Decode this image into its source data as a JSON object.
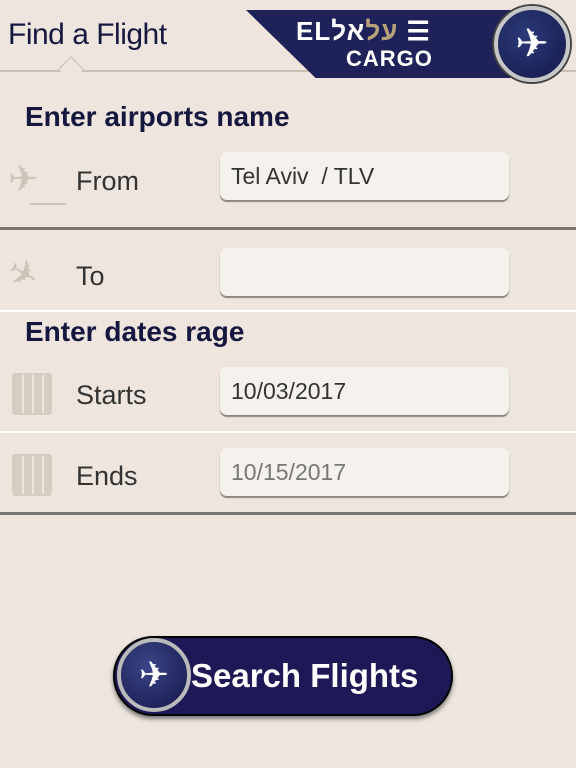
{
  "header": {
    "title": "Find a Flight",
    "logo_latin": "EL",
    "logo_hebrew": "על",
    "logo_hebrew2": "אל",
    "logo_sub": "CARGO"
  },
  "airports": {
    "heading": "Enter airports name",
    "from_label": "From",
    "from_value": "Tel Aviv  / TLV",
    "to_label": "To",
    "to_value": ""
  },
  "dates": {
    "heading": "Enter dates rage",
    "starts_label": "Starts",
    "starts_value": "10/03/2017",
    "ends_label": "Ends",
    "ends_value": "10/15/2017"
  },
  "search_button": {
    "label": "Search Flights"
  },
  "colors": {
    "brand_navy": "#1f1856",
    "background": "#ede5de"
  }
}
